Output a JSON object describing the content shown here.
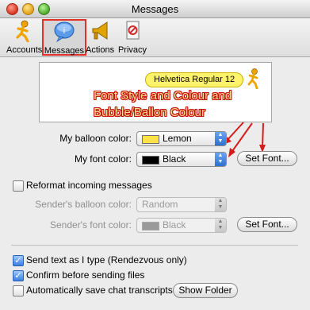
{
  "window": {
    "title": "Messages"
  },
  "toolbar": {
    "items": [
      {
        "label": "Accounts",
        "icon": "accounts-icon"
      },
      {
        "label": "Messages",
        "icon": "messages-icon",
        "selected": true
      },
      {
        "label": "Actions",
        "icon": "actions-icon"
      },
      {
        "label": "Privacy",
        "icon": "privacy-icon"
      }
    ]
  },
  "preview": {
    "balloon_text": "Helvetica Regular 12"
  },
  "annotation": {
    "text": "Font Style and Colour and Bubble/Ballon Colour",
    "color": "#c41010"
  },
  "balloon_color": {
    "label": "My balloon color:",
    "value": "Lemon",
    "swatch": "#ffe14a"
  },
  "font_color": {
    "label": "My font color:",
    "value": "Black",
    "swatch": "#000000"
  },
  "set_font_button": "Set Font...",
  "reformat": {
    "label": "Reformat incoming messages",
    "checked": false,
    "sender_balloon": {
      "label": "Sender's balloon color:",
      "value": "Random"
    },
    "sender_font": {
      "label": "Sender's font color:",
      "value": "Black",
      "swatch": "#9a9a9a"
    },
    "set_font_button": "Set Font..."
  },
  "options": [
    {
      "label": "Send text as I type (Rendezvous only)",
      "checked": true
    },
    {
      "label": "Confirm before sending files",
      "checked": true
    },
    {
      "label": "Automatically save chat transcripts",
      "checked": false
    }
  ],
  "show_folder_button": "Show Folder"
}
